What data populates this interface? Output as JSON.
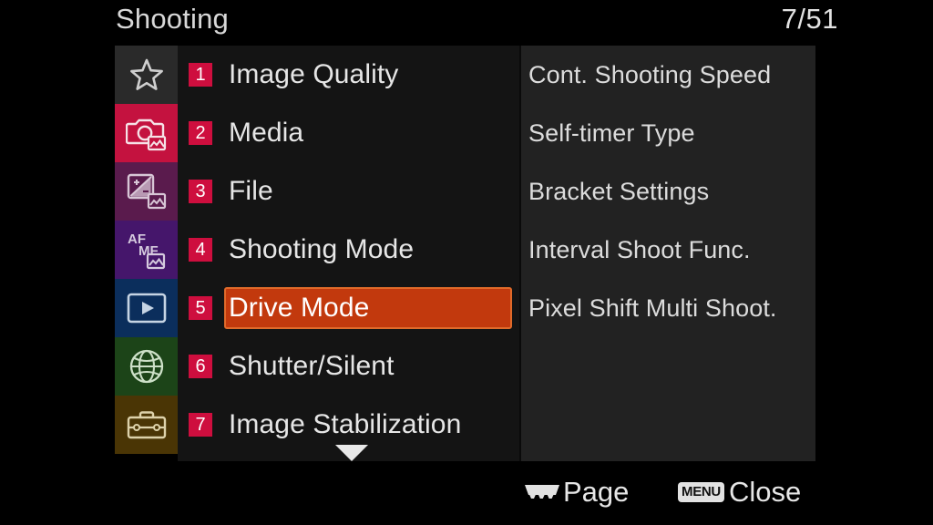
{
  "header": {
    "title": "Shooting",
    "page_indicator": "7/51",
    "current_page": 7,
    "total_pages": 51
  },
  "sidebar": {
    "items": [
      {
        "icon": "star-icon",
        "name": "my-menu",
        "bg": "#2a2a2a",
        "fg": "#cfcfcf",
        "selected": false
      },
      {
        "icon": "camera-photo-icon",
        "name": "shooting",
        "bg": "#c4123f",
        "fg": "#f2dde3",
        "selected": true
      },
      {
        "icon": "exposure-color-icon",
        "name": "exposure-color",
        "bg": "#5a1b4d",
        "fg": "#d8c6d6",
        "selected": false
      },
      {
        "icon": "af-mf-icon",
        "name": "focus",
        "bg": "#45166b",
        "fg": "#d5cade",
        "selected": false
      },
      {
        "icon": "playback-icon",
        "name": "playback",
        "bg": "#0b2e5c",
        "fg": "#c6d4e4",
        "selected": false
      },
      {
        "icon": "globe-network-icon",
        "name": "network",
        "bg": "#1c4418",
        "fg": "#cde0c8",
        "selected": false
      },
      {
        "icon": "toolbox-setup-icon",
        "name": "setup",
        "bg": "#4a3505",
        "fg": "#ddd2ab",
        "selected": false
      }
    ]
  },
  "menu": {
    "rows": [
      {
        "number": "1",
        "label": "Image Quality",
        "selected": false
      },
      {
        "number": "2",
        "label": "Media",
        "selected": false
      },
      {
        "number": "3",
        "label": "File",
        "selected": false
      },
      {
        "number": "4",
        "label": "Shooting Mode",
        "selected": false
      },
      {
        "number": "5",
        "label": "Drive Mode",
        "selected": true
      },
      {
        "number": "6",
        "label": "Shutter/Silent",
        "selected": false
      },
      {
        "number": "7",
        "label": "Image Stabilization",
        "selected": false
      }
    ],
    "scroll_down_indicator": true
  },
  "submenu": {
    "items": [
      {
        "label": "Cont. Shooting Speed"
      },
      {
        "label": "Self-timer Type"
      },
      {
        "label": "Bracket Settings"
      },
      {
        "label": "Interval Shoot Func."
      },
      {
        "label": "Pixel Shift Multi Shoot."
      }
    ]
  },
  "footer": {
    "page_action": {
      "icon": "control-dial-icon",
      "label": "Page"
    },
    "close_action": {
      "badge": "MENU",
      "label": "Close"
    }
  },
  "colors": {
    "background": "#000000",
    "mid_panel": "#141414",
    "right_panel": "#222222",
    "badge_red": "#ce0e3e",
    "highlight_fill": "#c2390d",
    "highlight_border": "#e06a2a",
    "text_primary": "#e6e6e6"
  }
}
